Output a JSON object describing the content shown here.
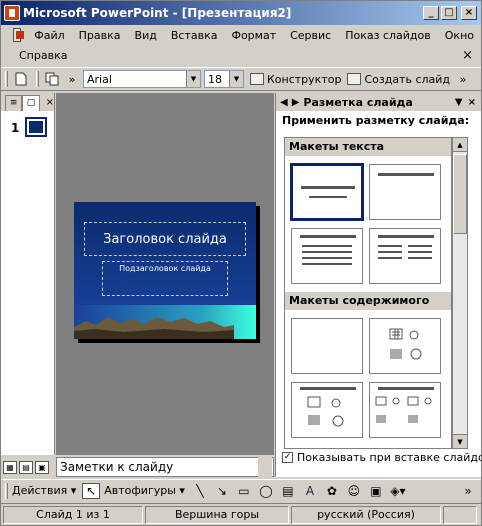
{
  "window": {
    "title": "Microsoft PowerPoint - [Презентация2]",
    "minimize": "_",
    "restore": "□",
    "close": "×"
  },
  "menu": {
    "row1": [
      "Файл",
      "Правка",
      "Вид",
      "Вставка",
      "Формат",
      "Сервис",
      "Показ слайдов",
      "Окно"
    ],
    "row2": [
      "Справка"
    ],
    "close": "×"
  },
  "toolbar": {
    "font": "Arial",
    "size": "18",
    "designer": "Конструктор",
    "new_slide": "Создать слайд"
  },
  "left_pane": {
    "slide_number": "1"
  },
  "slide": {
    "title_placeholder": "Заголовок слайда",
    "subtitle_placeholder": "Подзаголовок слайда"
  },
  "notes": {
    "placeholder": "Заметки к слайду"
  },
  "task_pane": {
    "title": "Разметка слайда",
    "apply_label": "Применить разметку слайда:",
    "section_text": "Макеты текста",
    "section_content": "Макеты содержимого",
    "show_on_insert": "Показывать при вставке слайдов"
  },
  "draw_toolbar": {
    "actions": "Действия",
    "autoshapes": "Автофигуры"
  },
  "status": {
    "slide": "Слайд 1 из 1",
    "design": "Вершина горы",
    "language": "русский (Россия)"
  }
}
